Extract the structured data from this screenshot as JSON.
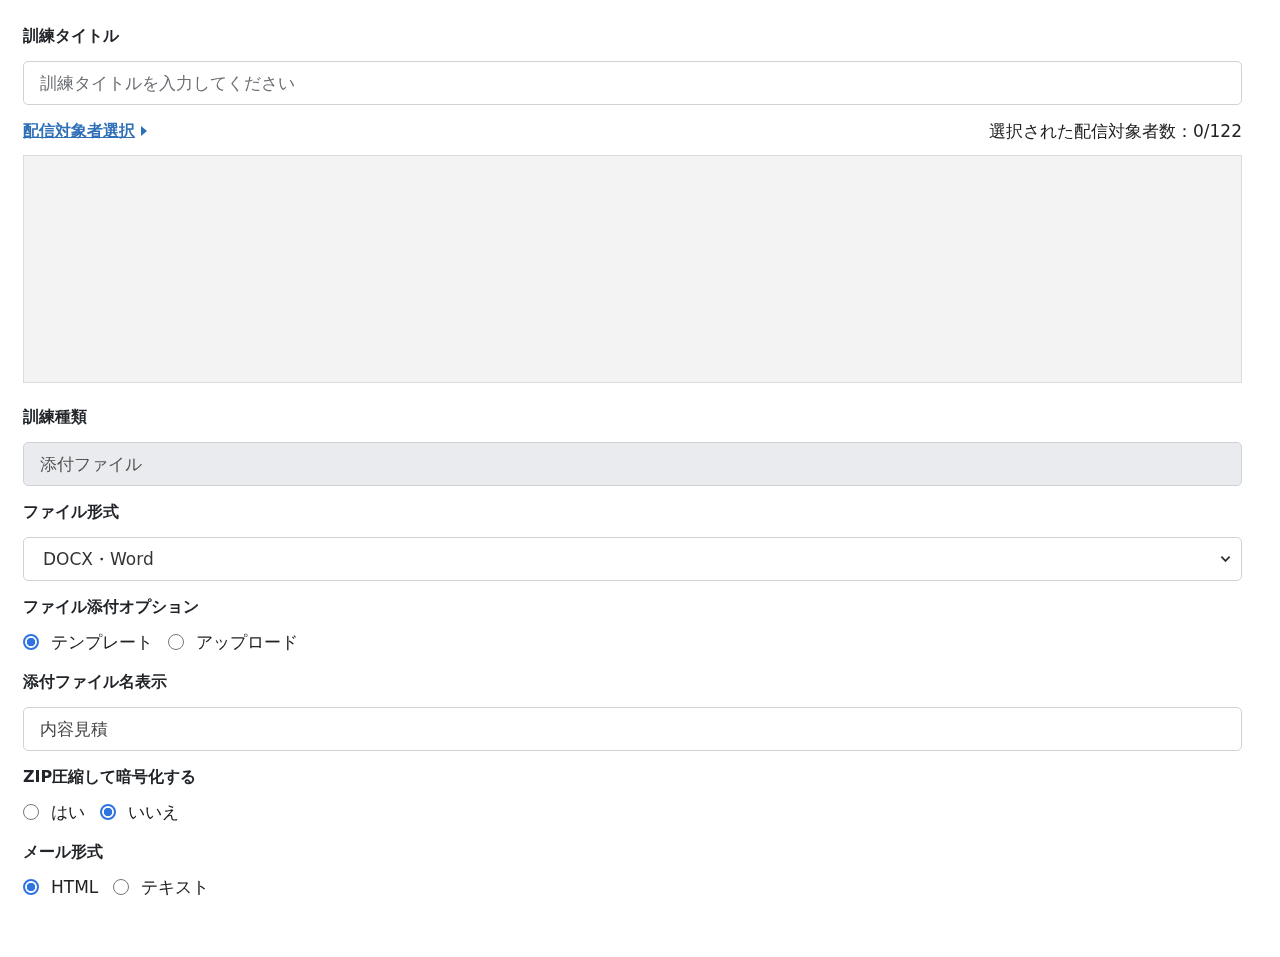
{
  "fields": [
    {
      "kind": "text",
      "label": "訓練タイトル",
      "placeholder": "訓練タイトルを入力してください",
      "disabled": false
    },
    {
      "kind": "recipients",
      "link": "配信対象者選択",
      "count": "選択された配信対象者数：0/122"
    },
    {
      "kind": "text",
      "label": "訓練種類",
      "value": "添付ファイル",
      "disabled": true
    },
    {
      "kind": "select",
      "label": "ファイル形式",
      "value": "DOCX・Word"
    },
    {
      "kind": "radio",
      "label": "ファイル添付オプション",
      "options": [
        {
          "label": "テンプレート",
          "selected": true
        },
        {
          "label": "アップロード",
          "selected": false
        }
      ]
    },
    {
      "kind": "text",
      "label": "添付ファイル名表示",
      "value": "内容見積",
      "disabled": false
    },
    {
      "kind": "radio",
      "label": "ZIP圧縮して暗号化する",
      "options": [
        {
          "label": "はい",
          "selected": false
        },
        {
          "label": "いいえ",
          "selected": true
        }
      ]
    },
    {
      "kind": "radio",
      "label": "メール形式",
      "options": [
        {
          "label": "HTML",
          "selected": true
        },
        {
          "label": "テキスト",
          "selected": false
        }
      ]
    }
  ]
}
